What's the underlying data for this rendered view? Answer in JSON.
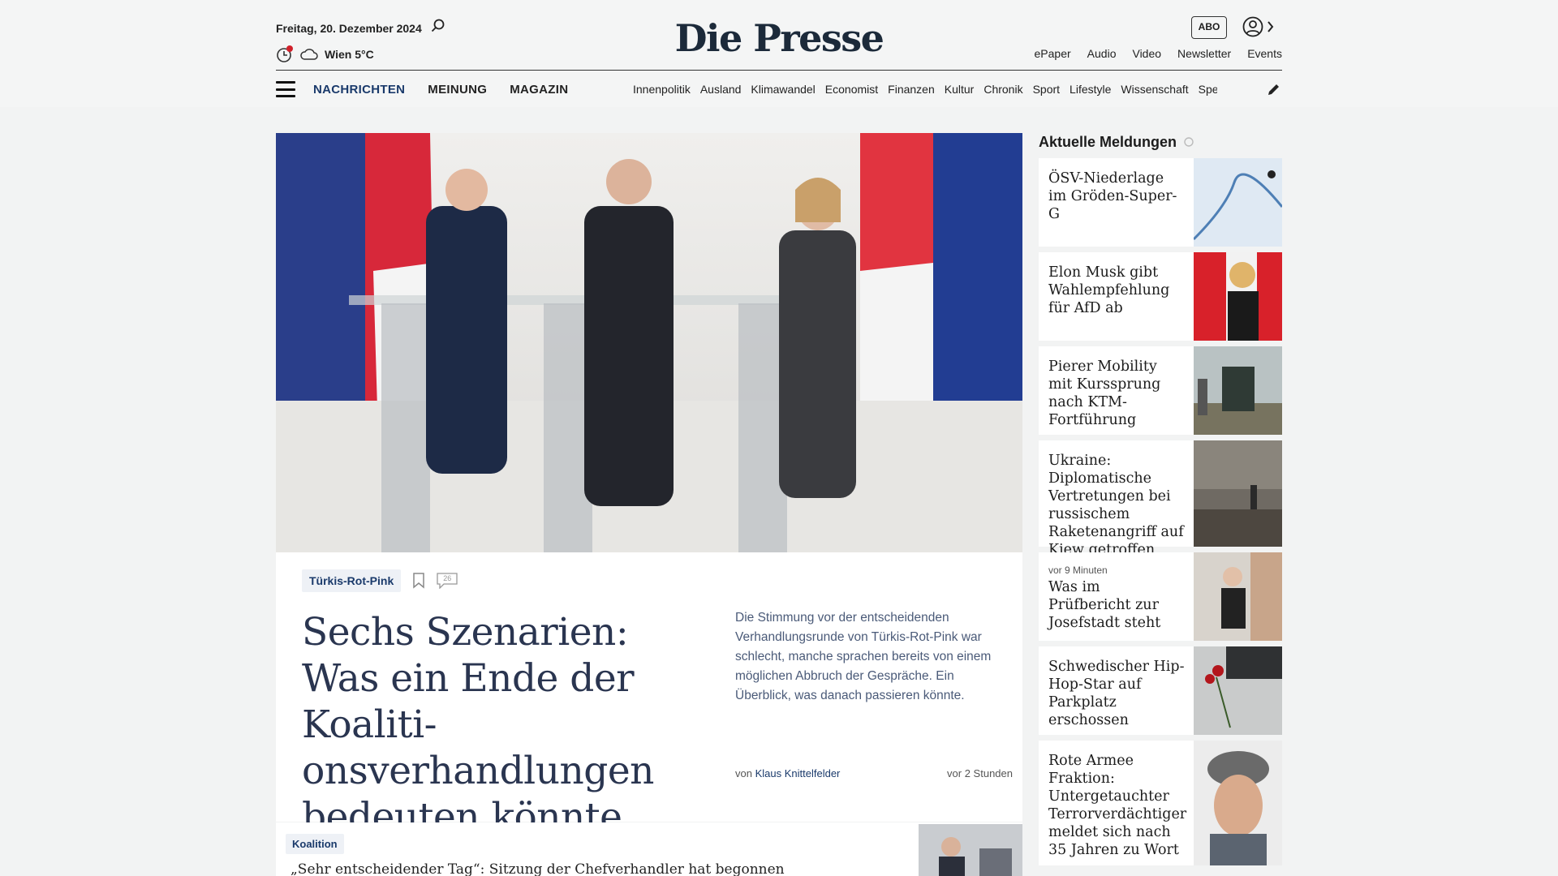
{
  "header": {
    "date": "Freitag, 20. Dezember 2024",
    "weather": "Wien 5°C",
    "logo": "Die Presse",
    "abo": "ABO",
    "links": [
      "ePaper",
      "Audio",
      "Video",
      "Newsletter",
      "Events"
    ]
  },
  "nav": {
    "main": [
      "NACHRICHTEN",
      "MEINUNG",
      "MAGAZIN"
    ],
    "sub": [
      "Innenpolitik",
      "Ausland",
      "Klimawandel",
      "Economist",
      "Finanzen",
      "Kultur",
      "Chronik",
      "Sport",
      "Lifestyle",
      "Wissenschaft",
      "Spectrum"
    ]
  },
  "lead": {
    "tag": "Türkis-Rot-Pink",
    "comments": "26",
    "headline": "Sechs Szenarien: Was ein Ende der Koaliti­onsverhandlungen bedeuten könnte",
    "teaser": "Die Stimmung vor der entscheidenden Verhandlungsrunde von Türkis-Rot-Pink war schlecht, manche sprachen bereits von einem möglichen Abbruch der Gespräche. Ein Überblick, was danach passieren könnte.",
    "by": "von",
    "author": "Klaus Knittelfelder",
    "time": "vor 2 Stunden"
  },
  "second": {
    "tag": "Koalition",
    "headline": "„Sehr entscheidender Tag“: Sitzung der Chefverhandler hat begonnen"
  },
  "sidebar": {
    "title": "Aktuelle Meldungen",
    "items": [
      {
        "text": "ÖSV-Niederlage im Gröden-Super-G"
      },
      {
        "text": "Elon Musk gibt Wahlempfehlung für AfD ab"
      },
      {
        "text": "Pierer Mobility mit Kurssprung nach KTM-Fortführung"
      },
      {
        "text": "Ukraine: Diplomati­sche Vertretungen bei russischem Raketenangriff auf Kiew getroffen"
      },
      {
        "ago": "vor 9 Minuten",
        "text": "Was im Prüfbericht zur Josefstadt steht"
      },
      {
        "text": "Schwedischer Hip-Hop-Star auf Parkplatz erschossen"
      },
      {
        "text": "Rote Armee Fraktion: Untergetauchter Terrorverdächtiger meldet sich nach 35 Jahren zu Wort"
      }
    ]
  }
}
